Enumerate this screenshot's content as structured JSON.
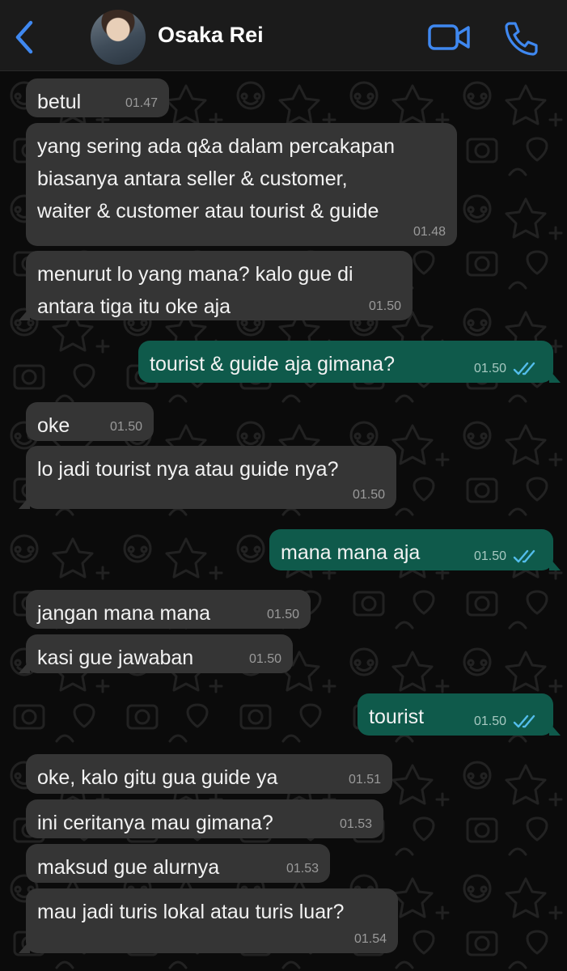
{
  "header": {
    "contact_name": "Osaka Rei",
    "icons": {
      "back": "chevron-left-icon",
      "video": "video-camera-icon",
      "call": "phone-icon"
    },
    "accent_color": "#3f88f0"
  },
  "colors": {
    "incoming_bubble": "#353535",
    "outgoing_bubble": "#0f5a4b",
    "read_ticks": "#53bdeb"
  },
  "messages": [
    {
      "direction": "in",
      "text": "betul",
      "time": "01.47"
    },
    {
      "direction": "in",
      "text": "yang sering ada q&a dalam percakapan\nbiasanya antara seller & customer,\nwaiter & customer atau tourist & guide",
      "time": "01.48"
    },
    {
      "direction": "in",
      "text": "menurut lo yang mana? kalo gue di\nantara tiga itu oke aja",
      "time": "01.50"
    },
    {
      "direction": "out",
      "text": "tourist & guide aja gimana?",
      "time": "01.50",
      "status": "read"
    },
    {
      "direction": "in",
      "text": "oke",
      "time": "01.50"
    },
    {
      "direction": "in",
      "text": "lo jadi tourist nya atau guide nya?",
      "time": "01.50"
    },
    {
      "direction": "out",
      "text": "mana mana aja",
      "time": "01.50",
      "status": "read"
    },
    {
      "direction": "in",
      "text": "jangan mana mana",
      "time": "01.50"
    },
    {
      "direction": "in",
      "text": "kasi gue jawaban",
      "time": "01.50"
    },
    {
      "direction": "out",
      "text": "tourist",
      "time": "01.50",
      "status": "read"
    },
    {
      "direction": "in",
      "text": "oke, kalo gitu gua guide ya",
      "time": "01.51"
    },
    {
      "direction": "in",
      "text": "ini ceritanya mau gimana?",
      "time": "01.53"
    },
    {
      "direction": "in",
      "text": "maksud gue alurnya",
      "time": "01.53"
    },
    {
      "direction": "in",
      "text": "mau jadi turis lokal atau turis luar?",
      "time": "01.54"
    }
  ]
}
